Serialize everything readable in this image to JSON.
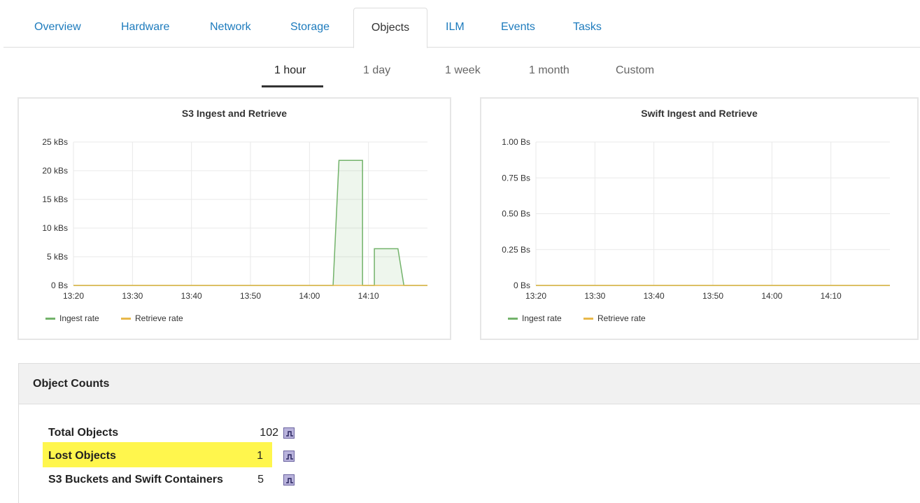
{
  "tabs": [
    {
      "label": "Overview",
      "active": false
    },
    {
      "label": "Hardware",
      "active": false
    },
    {
      "label": "Network",
      "active": false
    },
    {
      "label": "Storage",
      "active": false
    },
    {
      "label": "Objects",
      "active": true
    },
    {
      "label": "ILM",
      "active": false
    },
    {
      "label": "Events",
      "active": false
    },
    {
      "label": "Tasks",
      "active": false
    }
  ],
  "time_ranges": [
    {
      "label": "1 hour",
      "active": true
    },
    {
      "label": "1 day",
      "active": false
    },
    {
      "label": "1 week",
      "active": false
    },
    {
      "label": "1 month",
      "active": false
    },
    {
      "label": "Custom",
      "active": false
    }
  ],
  "chart_data": [
    {
      "type": "area",
      "title": "S3 Ingest and Retrieve",
      "x_ticks": [
        "13:20",
        "13:30",
        "13:40",
        "13:50",
        "14:00",
        "14:10"
      ],
      "y_ticks": [
        "0 Bs",
        "5 kBs",
        "10 kBs",
        "15 kBs",
        "20 kBs",
        "25 kBs"
      ],
      "ylim": [
        0,
        25
      ],
      "y_unit": "kBs",
      "grid": true,
      "legend_position": "bottom-left",
      "series": [
        {
          "name": "Ingest rate",
          "color": "#73b36b",
          "points": [
            [
              "13:20",
              0
            ],
            [
              "14:04",
              0
            ],
            [
              "14:05",
              21.8
            ],
            [
              "14:09",
              21.8
            ],
            [
              "14:09",
              0
            ],
            [
              "14:11",
              0
            ],
            [
              "14:11",
              6.4
            ],
            [
              "14:15",
              6.4
            ],
            [
              "14:16",
              0
            ],
            [
              "14:20",
              0
            ]
          ]
        },
        {
          "name": "Retrieve rate",
          "color": "#e8b84a",
          "points": [
            [
              "13:20",
              0
            ],
            [
              "14:20",
              0
            ]
          ]
        }
      ]
    },
    {
      "type": "line",
      "title": "Swift Ingest and Retrieve",
      "x_ticks": [
        "13:20",
        "13:30",
        "13:40",
        "13:50",
        "14:00",
        "14:10"
      ],
      "y_ticks": [
        "0 Bs",
        "0.25 Bs",
        "0.50 Bs",
        "0.75 Bs",
        "1.00 Bs"
      ],
      "ylim": [
        0,
        1
      ],
      "y_unit": "Bs",
      "grid": true,
      "legend_position": "bottom-left",
      "series": [
        {
          "name": "Ingest rate",
          "color": "#73b36b",
          "points": [
            [
              "13:20",
              0
            ],
            [
              "14:20",
              0
            ]
          ]
        },
        {
          "name": "Retrieve rate",
          "color": "#e8b84a",
          "points": [
            [
              "13:20",
              0
            ],
            [
              "14:20",
              0
            ]
          ]
        }
      ]
    }
  ],
  "object_counts": {
    "title": "Object Counts",
    "rows": [
      {
        "label": "Total Objects",
        "value": "102",
        "highlighted": false
      },
      {
        "label": "Lost Objects",
        "value": "1",
        "highlighted": true
      },
      {
        "label": "S3 Buckets and Swift Containers",
        "value": "5",
        "highlighted": false
      }
    ],
    "chart_icon": "chart-icon",
    "highlight_color": "#fff64d"
  }
}
